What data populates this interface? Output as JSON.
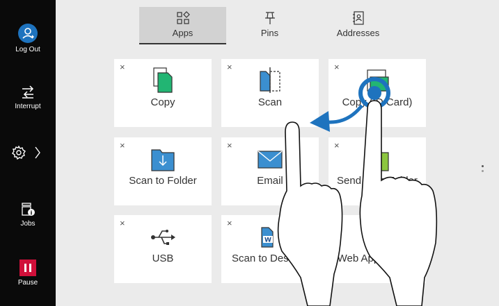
{
  "sidebar": {
    "logout_label": "Log Out",
    "interrupt_label": "Interrupt",
    "jobs_label": "Jobs",
    "pause_label": "Pause",
    "accent": "#1e73be",
    "pause_color": "#d0103a"
  },
  "tabs": [
    {
      "label": "Apps",
      "icon": "apps-grid-icon",
      "active": true
    },
    {
      "label": "Pins",
      "icon": "pin-icon",
      "active": false
    },
    {
      "label": "Addresses",
      "icon": "address-book-icon",
      "active": false
    }
  ],
  "tiles": [
    {
      "label": "Copy",
      "icon": "copy-icon"
    },
    {
      "label": "Scan",
      "icon": "scan-icon"
    },
    {
      "label": "Copy (ID Card)",
      "icon": "id-card-copy-icon"
    },
    {
      "label": "Scan to Folder",
      "icon": "scan-to-folder-icon"
    },
    {
      "label": "Email",
      "icon": "email-icon"
    },
    {
      "label": "Send from Folder",
      "icon": "send-from-folder-icon"
    },
    {
      "label": "USB",
      "icon": "usb-icon"
    },
    {
      "label": "Scan to Desktop",
      "icon": "scan-to-desktop-icon"
    },
    {
      "label": "Web Applications",
      "icon": "web-applications-icon"
    }
  ],
  "close_glyph": "×",
  "gesture": {
    "icon": "two-finger-swipe-left-icon"
  }
}
